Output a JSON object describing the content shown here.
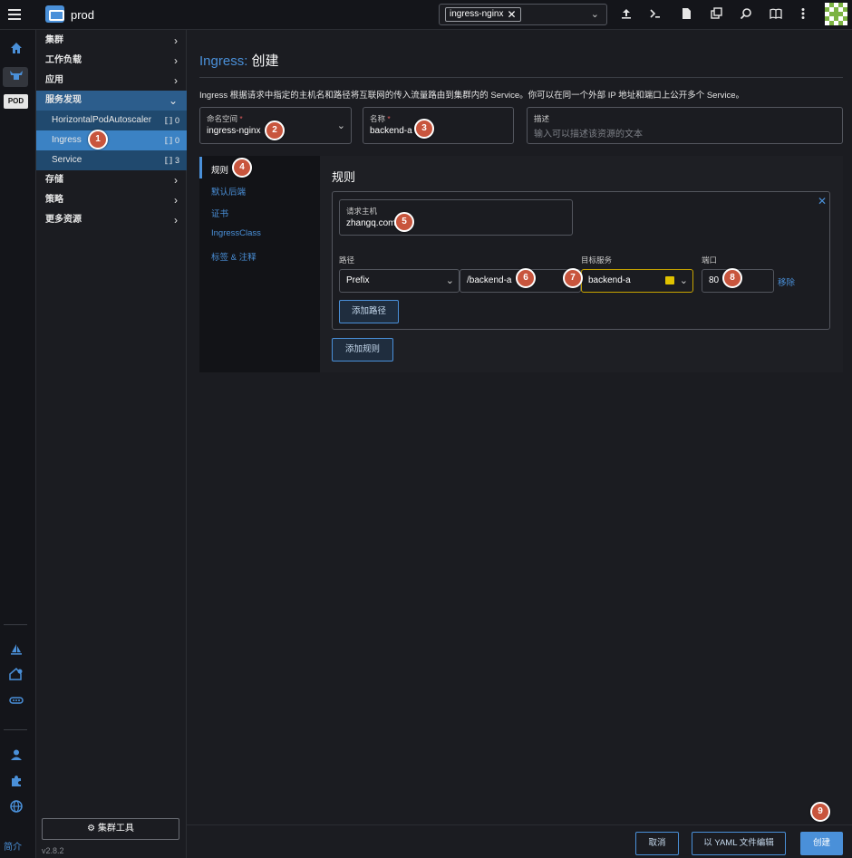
{
  "topbar": {
    "cluster_name": "prod",
    "namespace_chip": "ingress-nginx",
    "namespace_chip_remove": "✕",
    "namespace_dropdown_chevron": "⌄",
    "icons": [
      "upload-icon",
      "terminal-icon",
      "file-icon",
      "copy-icon",
      "search-icon",
      "book-icon",
      "more-vert-icon"
    ]
  },
  "rail": {
    "pod_badge": "POD",
    "bottom_label": "简介"
  },
  "sidenav": {
    "groups": [
      {
        "label": "集群",
        "chevron": "›"
      },
      {
        "label": "工作负载",
        "chevron": "›"
      },
      {
        "label": "应用",
        "chevron": "›"
      },
      {
        "label": "服务发现",
        "chevron": "⌄"
      },
      {
        "label": "存储",
        "chevron": "›"
      },
      {
        "label": "策略",
        "chevron": "›"
      },
      {
        "label": "更多资源",
        "chevron": "›"
      }
    ],
    "service_discovery_items": [
      {
        "label": "HorizontalPodAutoscaler",
        "count": "0"
      },
      {
        "label": "Ingress",
        "count": "0"
      },
      {
        "label": "Service",
        "count": "3"
      }
    ],
    "cluster_tools": "集群工具",
    "version": "v2.8.2"
  },
  "page": {
    "title_resource": "Ingress:",
    "title_action": "创建",
    "description": "Ingress 根据请求中指定的主机名和路径将互联网的传入流量路由到集群内的 Service。你可以在同一个外部 IP 地址和端口上公开多个 Service。"
  },
  "form": {
    "namespace": {
      "label": "命名空间",
      "required": "*",
      "value": "ingress-nginx"
    },
    "name": {
      "label": "名称",
      "required": "*",
      "value": "backend-a"
    },
    "description": {
      "label": "描述",
      "placeholder": "输入可以描述该资源的文本"
    }
  },
  "tabs": [
    "规则",
    "默认后端",
    "证书",
    "IngressClass",
    "标签 & 注释"
  ],
  "rules": {
    "heading": "规则",
    "close": "✕",
    "host_label": "请求主机",
    "host_value": "zhangq.com",
    "path_label": "路径",
    "target_service_label": "目标服务",
    "port_label": "端口",
    "path_type": "Prefix",
    "path_value": "/backend-a",
    "target_service": "backend-a",
    "port": "80",
    "remove": "移除",
    "add_path": "添加路径",
    "add_rule": "添加规则"
  },
  "footer": {
    "cancel": "取消",
    "edit_yaml": "以 YAML 文件编辑",
    "create": "创建"
  },
  "markers": [
    "1",
    "2",
    "3",
    "4",
    "5",
    "6",
    "7",
    "8",
    "9"
  ],
  "colors": {
    "accent": "#4a90d9",
    "marker": "#c8553d",
    "warning": "#e0c200",
    "background": "#1b1c21"
  }
}
